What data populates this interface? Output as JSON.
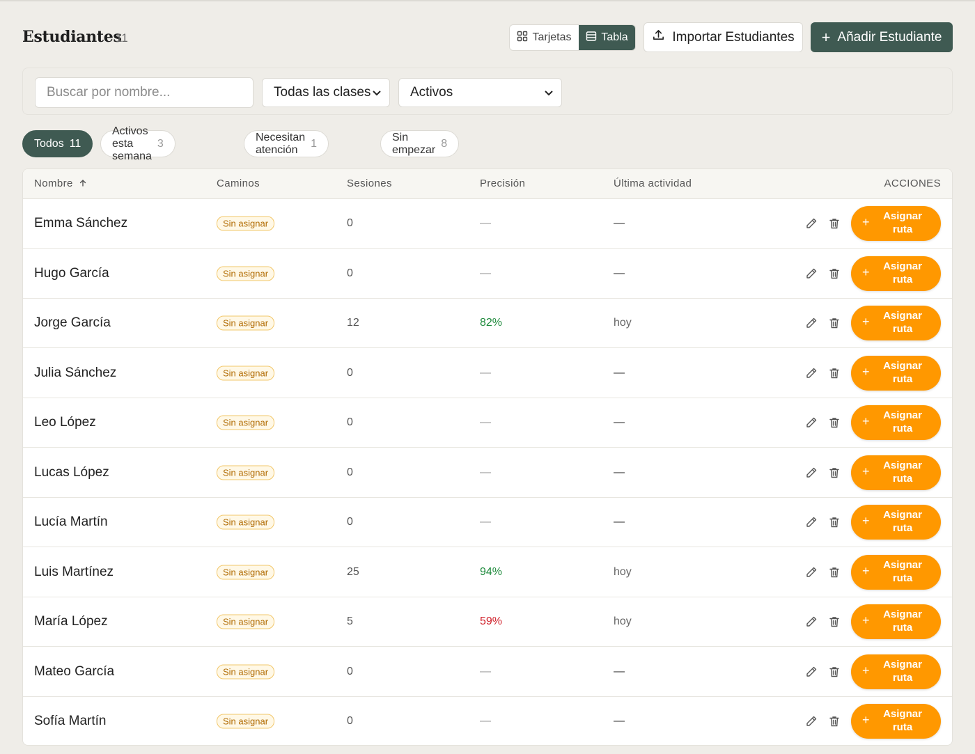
{
  "header": {
    "title": "Estudiantes",
    "count": "11",
    "view_cards_label": "Tarjetas",
    "view_table_label": "Tabla",
    "import_label": "Importar Estudiantes",
    "add_label": "Añadir Estudiante"
  },
  "filters": {
    "search_placeholder": "Buscar por nombre...",
    "class_value": "Todas las clases",
    "status_value": "Activos"
  },
  "chips": [
    {
      "label": "Todos",
      "count": "11",
      "active": true
    },
    {
      "label": "Activos esta semana",
      "count": "3",
      "active": false
    },
    {
      "label": "Necesitan atención",
      "count": "1",
      "active": false
    },
    {
      "label": "Sin empezar",
      "count": "8",
      "active": false
    }
  ],
  "table": {
    "columns": {
      "name": "Nombre",
      "paths": "Caminos",
      "sessions": "Sesiones",
      "precision": "Precisión",
      "activity": "Última actividad",
      "actions": "ACCIONES"
    },
    "assign_label": "Asignar ruta",
    "rows": [
      {
        "name": "Emma Sánchez",
        "path": "Sin asignar",
        "sessions": "0",
        "precision": "—",
        "activity": "—"
      },
      {
        "name": "Hugo García",
        "path": "Sin asignar",
        "sessions": "0",
        "precision": "—",
        "activity": "—"
      },
      {
        "name": "Jorge García",
        "path": "Sin asignar",
        "sessions": "12",
        "precision": "82%",
        "activity": "hoy"
      },
      {
        "name": "Julia Sánchez",
        "path": "Sin asignar",
        "sessions": "0",
        "precision": "—",
        "activity": "—"
      },
      {
        "name": "Leo López",
        "path": "Sin asignar",
        "sessions": "0",
        "precision": "—",
        "activity": "—"
      },
      {
        "name": "Lucas López",
        "path": "Sin asignar",
        "sessions": "0",
        "precision": "—",
        "activity": "—"
      },
      {
        "name": "Lucía Martín",
        "path": "Sin asignar",
        "sessions": "0",
        "precision": "—",
        "activity": "—"
      },
      {
        "name": "Luis Martínez",
        "path": "Sin asignar",
        "sessions": "25",
        "precision": "94%",
        "activity": "hoy"
      },
      {
        "name": "María López",
        "path": "Sin asignar",
        "sessions": "5",
        "precision": "59%",
        "activity": "hoy"
      },
      {
        "name": "Mateo García",
        "path": "Sin asignar",
        "sessions": "0",
        "precision": "—",
        "activity": "—"
      },
      {
        "name": "Sofía Martín",
        "path": "Sin asignar",
        "sessions": "0",
        "precision": "—",
        "activity": "—"
      }
    ]
  },
  "colors": {
    "primary": "#3f5a52",
    "accent": "#ff9800",
    "good": "#1e8a3c",
    "bad": "#d0202a",
    "badge_text": "#b06a00",
    "background": "#efede8"
  }
}
